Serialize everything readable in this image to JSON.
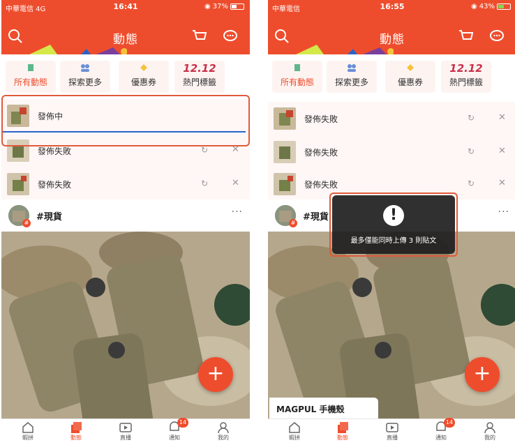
{
  "colors": {
    "brand": "#ee4d2d",
    "progress": "#2b63c8",
    "highlight": "#e05a3a"
  },
  "left": {
    "status": {
      "carrier": "中華電信 4G",
      "time": "16:41",
      "battery": "37%",
      "battery_level": 0.37
    },
    "header": {
      "title": "動態"
    },
    "tabs": [
      {
        "label": "所有動態",
        "icon": "pages-icon"
      },
      {
        "label": "探索更多",
        "icon": "people-icon"
      },
      {
        "label": "優惠券",
        "icon": "coupon-icon"
      },
      {
        "label": "熱門標籤",
        "badge_text": "12.12"
      }
    ],
    "uploads": [
      {
        "status": "發佈中"
      },
      {
        "status": "發佈失敗"
      },
      {
        "status": "發佈失敗"
      }
    ],
    "post": {
      "tag": "#現貨",
      "more": "···"
    },
    "nav": [
      {
        "label": "蝦拼",
        "icon": "home-icon"
      },
      {
        "label": "動態",
        "icon": "feed-icon"
      },
      {
        "label": "直播",
        "icon": "live-icon"
      },
      {
        "label": "通知",
        "icon": "bell-icon",
        "badge": "14"
      },
      {
        "label": "我的",
        "icon": "profile-icon"
      }
    ]
  },
  "right": {
    "status": {
      "carrier": "中華電信",
      "time": "16:55",
      "battery": "43%",
      "battery_level": 0.43
    },
    "header": {
      "title": "動態"
    },
    "tabs": [
      {
        "label": "所有動態",
        "icon": "pages-icon"
      },
      {
        "label": "探索更多",
        "icon": "people-icon"
      },
      {
        "label": "優惠券",
        "icon": "coupon-icon"
      },
      {
        "label": "熱門標籤",
        "badge_text": "12.12"
      }
    ],
    "uploads": [
      {
        "status": "發佈失敗"
      },
      {
        "status": "發佈失敗"
      },
      {
        "status": "發佈失敗"
      }
    ],
    "post": {
      "tag": "#現貨",
      "more": "···"
    },
    "toast": {
      "message": "最多僅能同時上傳 3 則貼文"
    },
    "caption": "MAGPUL 手機殼",
    "nav": [
      {
        "label": "蝦拼",
        "icon": "home-icon"
      },
      {
        "label": "動態",
        "icon": "feed-icon"
      },
      {
        "label": "直播",
        "icon": "live-icon"
      },
      {
        "label": "通知",
        "icon": "bell-icon",
        "badge": "14"
      },
      {
        "label": "我的",
        "icon": "profile-icon"
      }
    ]
  }
}
